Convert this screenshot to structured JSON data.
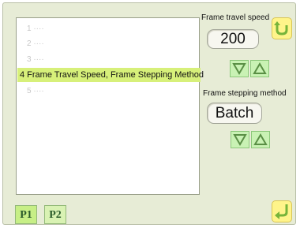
{
  "list": {
    "items": [
      {
        "label": "1 ····"
      },
      {
        "label": "2 ····"
      },
      {
        "label": "3 ····"
      },
      {
        "label": "4 Frame Travel Speed, Frame Stepping Method"
      },
      {
        "label": "5 ····"
      }
    ]
  },
  "travel": {
    "label": "Frame travel speed",
    "value": "200"
  },
  "stepping": {
    "label": "Frame stepping method",
    "value": "Batch"
  },
  "tabs": [
    {
      "label": "P1"
    },
    {
      "label": "P2"
    }
  ],
  "colors": {
    "panel_bg": "#e7ecd6",
    "highlight": "#d7f07a",
    "button_green": "#c9f2b4",
    "corner_yellow": "#fff48a"
  }
}
